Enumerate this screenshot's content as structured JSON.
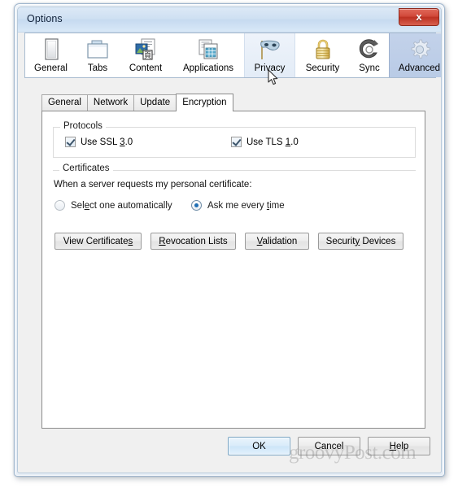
{
  "window": {
    "title": "Options",
    "close_label": "x",
    "close_icon": "close-icon"
  },
  "toolbar": {
    "items": [
      {
        "label": "General",
        "icon": "general-icon",
        "state": "normal"
      },
      {
        "label": "Tabs",
        "icon": "tabs-icon",
        "state": "normal"
      },
      {
        "label": "Content",
        "icon": "content-icon",
        "state": "normal"
      },
      {
        "label": "Applications",
        "icon": "applications-icon",
        "state": "normal"
      },
      {
        "label": "Privacy",
        "icon": "privacy-mask-icon",
        "state": "hovered"
      },
      {
        "label": "Security",
        "icon": "padlock-icon",
        "state": "normal"
      },
      {
        "label": "Sync",
        "icon": "sync-icon",
        "state": "normal"
      },
      {
        "label": "Advanced",
        "icon": "gear-icon",
        "state": "selected"
      }
    ]
  },
  "subtabs": {
    "items": [
      {
        "label": "General",
        "active": false
      },
      {
        "label": "Network",
        "active": false
      },
      {
        "label": "Update",
        "active": false
      },
      {
        "label": "Encryption",
        "active": true
      }
    ]
  },
  "protocols": {
    "group_title": "Protocols",
    "ssl": {
      "label_pre": "Use SSL ",
      "label_accel": "3",
      "label_post": ".0",
      "checked": true
    },
    "tls": {
      "label_pre": "Use TLS ",
      "label_accel": "1",
      "label_post": ".0",
      "checked": true
    }
  },
  "certificates": {
    "group_title": "Certificates",
    "prompt": "When a server requests my personal certificate:",
    "radio_auto": {
      "pre": "Sel",
      "accel": "e",
      "post": "ct one automatically",
      "selected": false
    },
    "radio_ask": {
      "pre": "Ask me every ",
      "accel": "t",
      "post": "ime",
      "selected": true
    },
    "buttons": [
      {
        "pre": "View Certificate",
        "accel": "s",
        "post": ""
      },
      {
        "pre": "",
        "accel": "R",
        "post": "evocation Lists"
      },
      {
        "pre": "",
        "accel": "V",
        "post": "alidation"
      },
      {
        "pre": "Securit",
        "accel": "y",
        "post": " Devices"
      }
    ]
  },
  "dialog_buttons": {
    "ok": {
      "label": "OK",
      "default": true
    },
    "cancel": {
      "label": "Cancel",
      "default": false
    },
    "help": {
      "pre": "",
      "accel": "H",
      "post": "elp",
      "default": false
    }
  },
  "watermark": {
    "text": "groovyPost.com"
  },
  "colors": {
    "accent_selected_tab": "#b9cbe6",
    "accent_radio_dot": "#1f6fb5",
    "close_button_red": "#bd3122",
    "titlebar_blue": "#cfe0f2"
  }
}
